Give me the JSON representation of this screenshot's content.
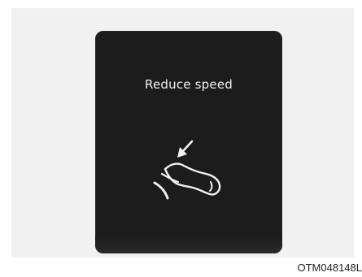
{
  "display": {
    "message": "Reduce speed",
    "icon": "foot-release-pedal-icon"
  },
  "figure_code": "OTM048148L",
  "colors": {
    "background": "#f1f1f1",
    "screen": "#1c1c1c",
    "text": "#f2f2f2"
  }
}
